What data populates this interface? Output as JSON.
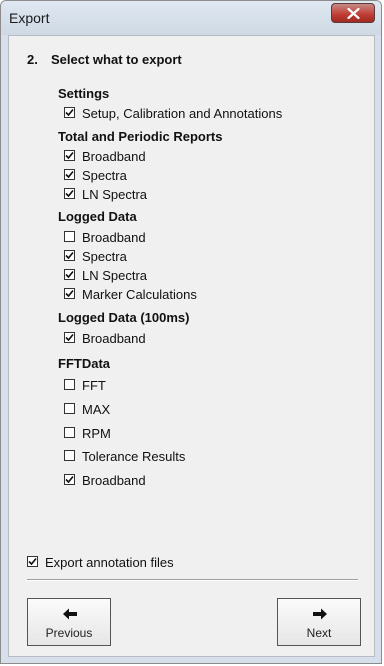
{
  "window": {
    "title": "Export"
  },
  "step": {
    "number": "2.",
    "title": "Select what to export"
  },
  "sections": {
    "settings": {
      "label": "Settings",
      "items": [
        {
          "label": "Setup, Calibration and Annotations",
          "checked": true
        }
      ]
    },
    "reports": {
      "label": "Total and Periodic Reports",
      "items": [
        {
          "label": "Broadband",
          "checked": true
        },
        {
          "label": "Spectra",
          "checked": true
        },
        {
          "label": "LN Spectra",
          "checked": true
        }
      ]
    },
    "logged": {
      "label": "Logged Data",
      "items": [
        {
          "label": "Broadband",
          "checked": false
        },
        {
          "label": "Spectra",
          "checked": true
        },
        {
          "label": "LN Spectra",
          "checked": true
        },
        {
          "label": "Marker Calculations",
          "checked": true
        }
      ]
    },
    "logged100": {
      "label": "Logged Data (100ms)",
      "items": [
        {
          "label": "Broadband",
          "checked": true
        }
      ]
    },
    "fft": {
      "label": "FFTData",
      "items": [
        {
          "label": "FFT",
          "checked": false
        },
        {
          "label": "MAX",
          "checked": false
        },
        {
          "label": "RPM",
          "checked": false
        },
        {
          "label": "Tolerance Results",
          "checked": false
        },
        {
          "label": "Broadband",
          "checked": true
        }
      ]
    }
  },
  "export_annotation": {
    "label": "Export annotation files",
    "checked": true
  },
  "buttons": {
    "previous": "Previous",
    "next": "Next"
  },
  "icons": {
    "close": "close-icon",
    "check": "check-icon",
    "arrow_left": "arrow-left-icon",
    "arrow_right": "arrow-right-icon"
  },
  "colors": {
    "frame": "#d7e0ea",
    "client": "#f0f0f0",
    "close_button": "#c23b32"
  }
}
